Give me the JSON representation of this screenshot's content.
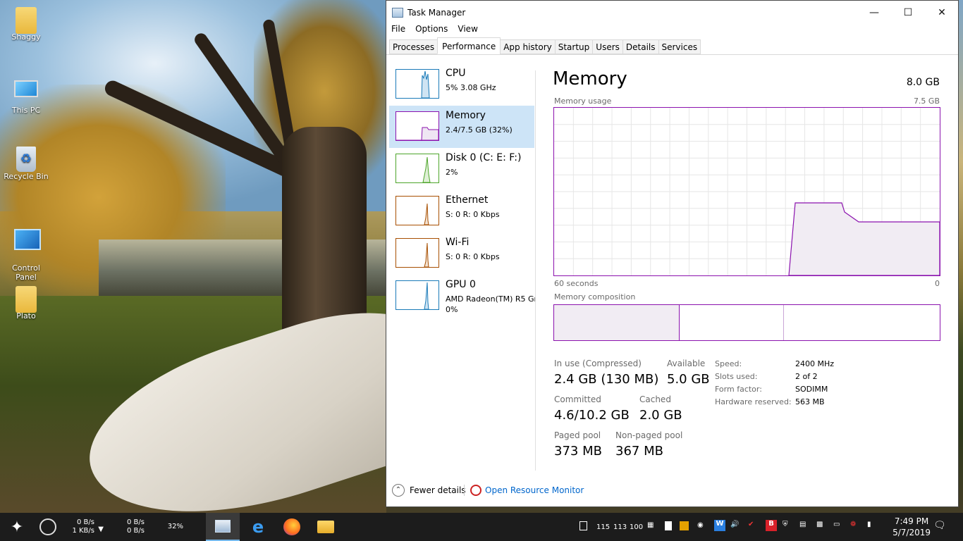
{
  "desktop": {
    "icons": [
      {
        "label": "Shaggy"
      },
      {
        "label": "This PC"
      },
      {
        "label": "Recycle Bin"
      },
      {
        "label": "Control\nPanel"
      },
      {
        "label": "Plato"
      }
    ]
  },
  "window": {
    "title": "Task Manager",
    "menu": [
      "File",
      "Options",
      "View"
    ],
    "tabs": [
      "Processes",
      "Performance",
      "App history",
      "Startup",
      "Users",
      "Details",
      "Services"
    ],
    "active_tab": "Performance",
    "sidebar": [
      {
        "name": "CPU",
        "sub1": "5%  3.08 GHz",
        "sub2": "",
        "color": "#1a7ab8"
      },
      {
        "name": "Memory",
        "sub1": "2.4/7.5 GB (32%)",
        "sub2": "",
        "color": "#8b12ae",
        "selected": true
      },
      {
        "name": "Disk 0 (C: E: F:)",
        "sub1": "2%",
        "sub2": "",
        "color": "#4da52a"
      },
      {
        "name": "Ethernet",
        "sub1": "S: 0  R: 0 Kbps",
        "sub2": "",
        "color": "#a74f01"
      },
      {
        "name": "Wi-Fi",
        "sub1": "S: 0  R: 0 Kbps",
        "sub2": "",
        "color": "#a74f01"
      },
      {
        "name": "GPU 0",
        "sub1": "AMD Radeon(TM) R5 Gr",
        "sub2": "0%",
        "color": "#1a7ab8"
      }
    ],
    "main": {
      "title": "Memory",
      "total": "8.0 GB",
      "usage_label": "Memory usage",
      "usage_max": "7.5 GB",
      "time_left": "60 seconds",
      "time_right": "0",
      "composition_label": "Memory composition",
      "in_use_label": "In use (Compressed)",
      "in_use_value": "2.4 GB (130 MB)",
      "available_label": "Available",
      "available_value": "5.0 GB",
      "committed_label": "Committed",
      "committed_value": "4.6/10.2 GB",
      "cached_label": "Cached",
      "cached_value": "2.0 GB",
      "paged_label": "Paged pool",
      "paged_value": "373 MB",
      "nonpaged_label": "Non-paged pool",
      "nonpaged_value": "367 MB",
      "speed_label": "Speed:",
      "speed_value": "2400 MHz",
      "slots_label": "Slots used:",
      "slots_value": "2 of 2",
      "form_label": "Form factor:",
      "form_value": "SODIMM",
      "hw_label": "Hardware reserved:",
      "hw_value": "563 MB"
    },
    "footer": {
      "fewer": "Fewer details",
      "resmon": "Open Resource Monitor"
    }
  },
  "taskbar": {
    "net1_up": "0 B/s",
    "net1_down": "1 KB/s",
    "net2_up": "0 B/s",
    "net2_down": "0 B/s",
    "mem_pct": "32%",
    "tray_nums": [
      "115",
      "113",
      "100"
    ],
    "time": "7:49 PM",
    "date": "5/7/2019"
  },
  "colors": {
    "memory": "#8b12ae",
    "selection": "#cde4f7",
    "link": "#0066cc"
  }
}
